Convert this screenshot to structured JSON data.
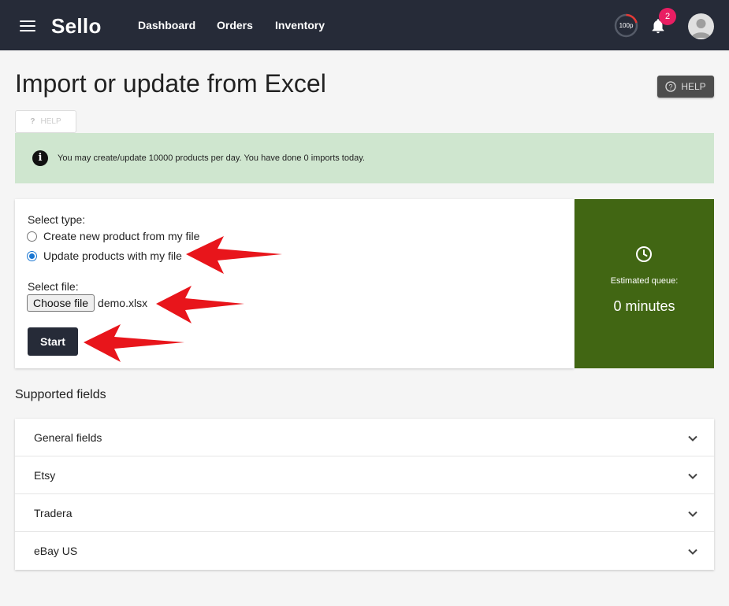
{
  "header": {
    "brand": "Sello",
    "nav": [
      "Dashboard",
      "Orders",
      "Inventory"
    ],
    "quota_label": "100p",
    "notification_count": "2",
    "icons": {
      "menu": "hamburger-icon",
      "notifications": "bell-icon",
      "account": "avatar-icon"
    }
  },
  "page": {
    "title": "Import or update from Excel",
    "help_label": "HELP",
    "help_small_label": "HELP"
  },
  "info": {
    "text": "You may create/update 10000 products per day. You have done 0 imports today.",
    "icon": "info-icon"
  },
  "import_form": {
    "select_type_label": "Select type:",
    "options": [
      {
        "label": "Create new product from my file",
        "selected": false
      },
      {
        "label": "Update products with my file",
        "selected": true
      }
    ],
    "select_file_label": "Select file:",
    "choose_file_label": "Choose file",
    "file_name": "demo.xlsx",
    "start_label": "Start"
  },
  "queue": {
    "label": "Estimated queue:",
    "value": "0 minutes",
    "icon": "clock-icon",
    "color": "#416613"
  },
  "supported_fields": {
    "title": "Supported fields",
    "items": [
      "General fields",
      "Etsy",
      "Tradera",
      "eBay US"
    ]
  },
  "colors": {
    "topbar": "#262b38",
    "info_banner": "#cfe6cf",
    "badge": "#e91e63",
    "annotation_arrow": "#e8151b"
  }
}
